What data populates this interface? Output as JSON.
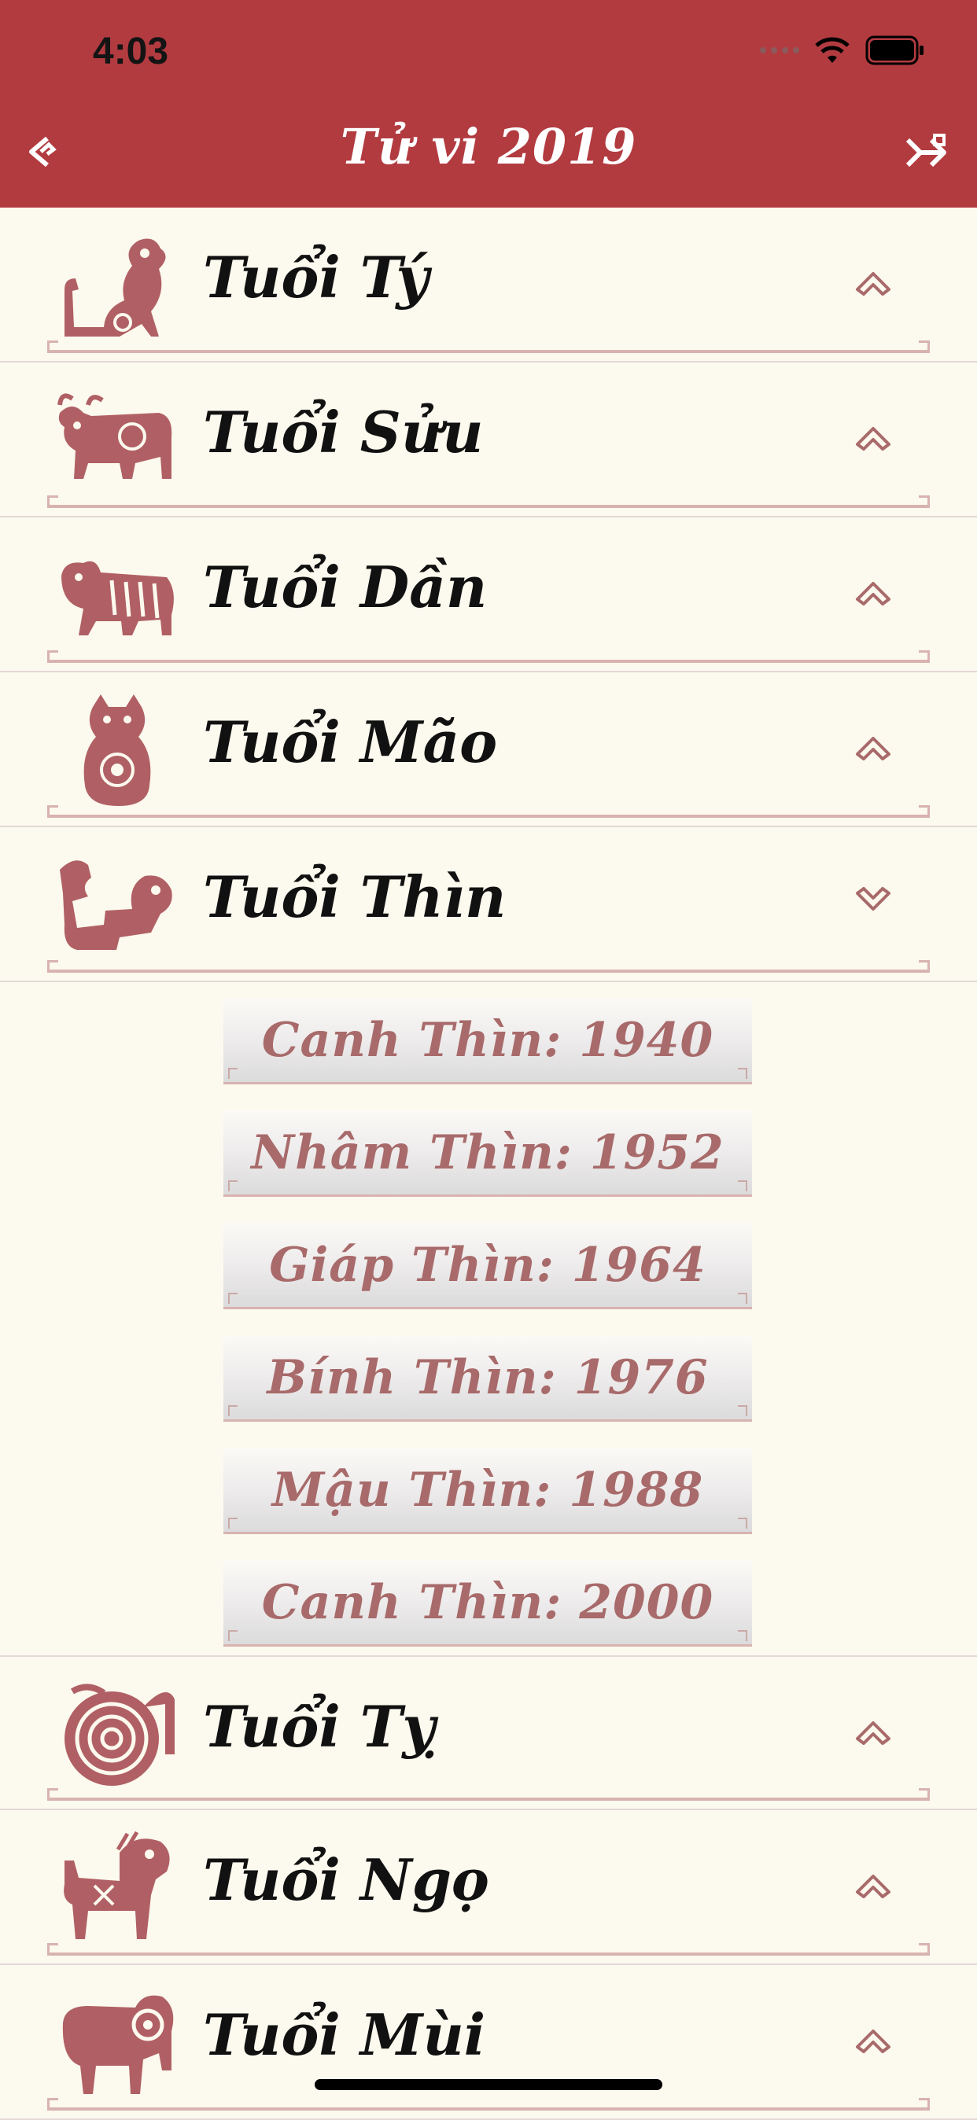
{
  "status": {
    "time": "4:03"
  },
  "nav": {
    "title": "Tử vi 2019"
  },
  "rows": [
    {
      "label": "Tuổi Tý",
      "icon": "rat-icon"
    },
    {
      "label": "Tuổi Sửu",
      "icon": "ox-icon"
    },
    {
      "label": "Tuổi Dần",
      "icon": "tiger-icon"
    },
    {
      "label": "Tuổi Mão",
      "icon": "cat-icon"
    },
    {
      "label": "Tuổi Thìn",
      "icon": "dragon-icon",
      "expanded": true
    },
    {
      "label": "Tuổi Tỵ",
      "icon": "snake-icon"
    },
    {
      "label": "Tuổi Ngọ",
      "icon": "horse-icon"
    },
    {
      "label": "Tuổi Mùi",
      "icon": "goat-icon"
    }
  ],
  "thin_years": [
    "Canh Thìn: 1940",
    "Nhâm Thìn: 1952",
    "Giáp Thìn: 1964",
    "Bính Thìn: 1976",
    "Mậu Thìn: 1988",
    "Canh Thìn: 2000"
  ],
  "colors": {
    "header": "#b23b40",
    "background": "#fcf9ee",
    "accent": "#a86a6a"
  }
}
